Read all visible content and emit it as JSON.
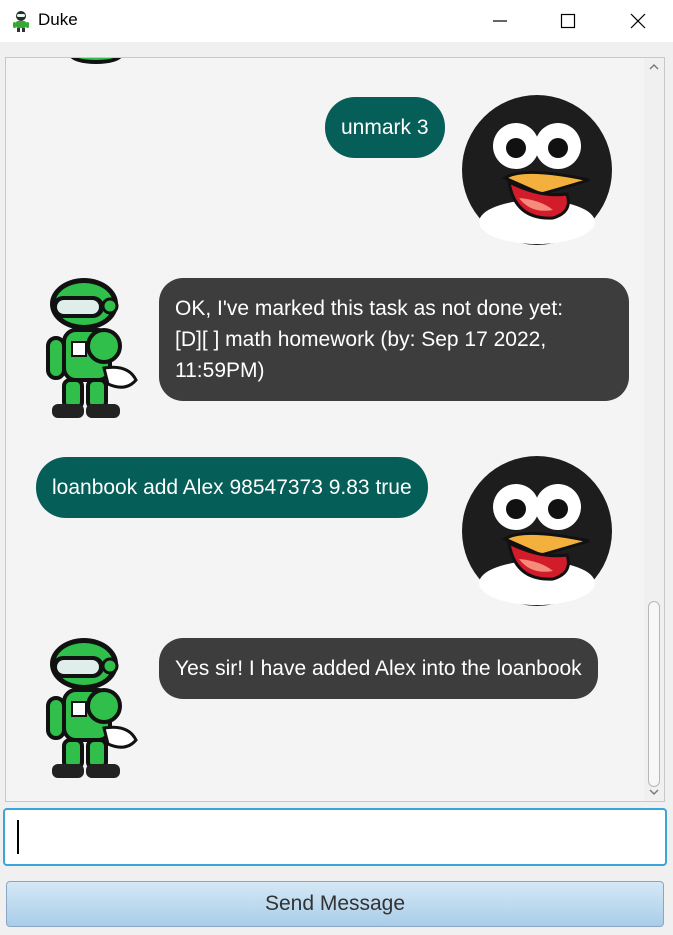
{
  "window": {
    "title": "Duke",
    "controls": [
      "minimize",
      "maximize",
      "close"
    ]
  },
  "chat": {
    "messages": [
      {
        "sender": "user",
        "text": "unmark 3"
      },
      {
        "sender": "duke",
        "text": "OK, I've marked this task as not done yet:\n[D][ ] math homework (by: Sep 17 2022, 11:59PM)"
      },
      {
        "sender": "user",
        "text": "loanbook add Alex 98547373 9.83 true"
      },
      {
        "sender": "duke",
        "text": "Yes sir! I have added Alex into the loanbook"
      }
    ]
  },
  "input": {
    "value": "",
    "placeholder": ""
  },
  "send_button": {
    "label": "Send Message"
  },
  "colors": {
    "user_bubble": "#065e59",
    "duke_bubble": "#3d3d3d",
    "accent_border": "#3aa6d8"
  },
  "icons": {
    "app": "robot-icon",
    "user_avatar": "penguin-avatar",
    "duke_avatar": "robot-avatar"
  }
}
